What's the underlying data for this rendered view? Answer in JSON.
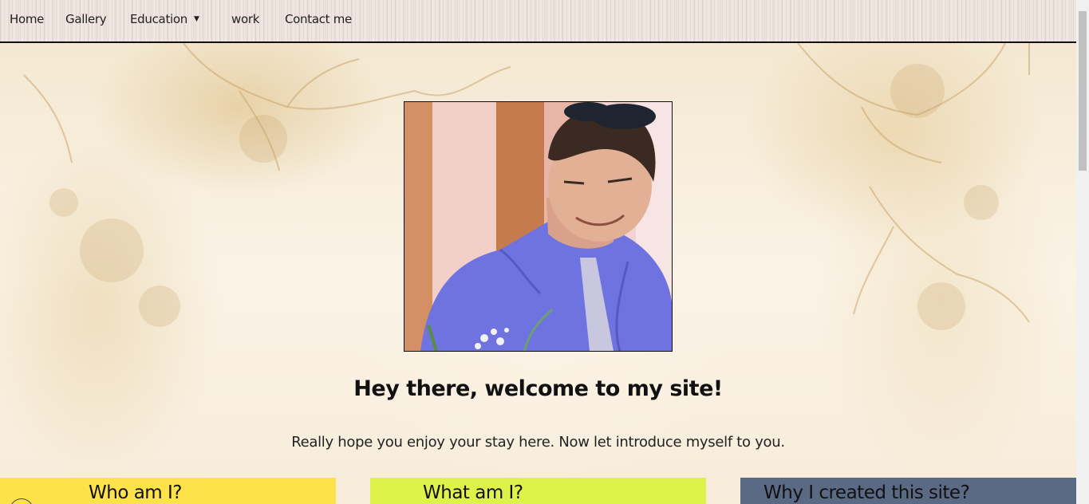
{
  "nav": {
    "items": [
      {
        "label": "Home"
      },
      {
        "label": "Gallery"
      },
      {
        "label": "Education",
        "dropdown": true
      },
      {
        "label": "work"
      },
      {
        "label": "Contact me"
      }
    ],
    "caret_icon": "triangle-down-icon"
  },
  "hero": {
    "heading": "Hey there, welcome to my site!",
    "intro": "Really hope you enjoy your stay here. Now let introduce myself to you."
  },
  "cards": [
    {
      "title": "Who am I?",
      "color": "#fde349"
    },
    {
      "title": "What am I?",
      "color": "#dff24a"
    },
    {
      "title": "Why I created this site?",
      "color": "#5b6a84"
    }
  ],
  "colors": {
    "nav_bg": "#efe6e1",
    "page_bg": "#f8efdd",
    "shirt": "#6f73e0",
    "tie": "#c9c7e0"
  }
}
